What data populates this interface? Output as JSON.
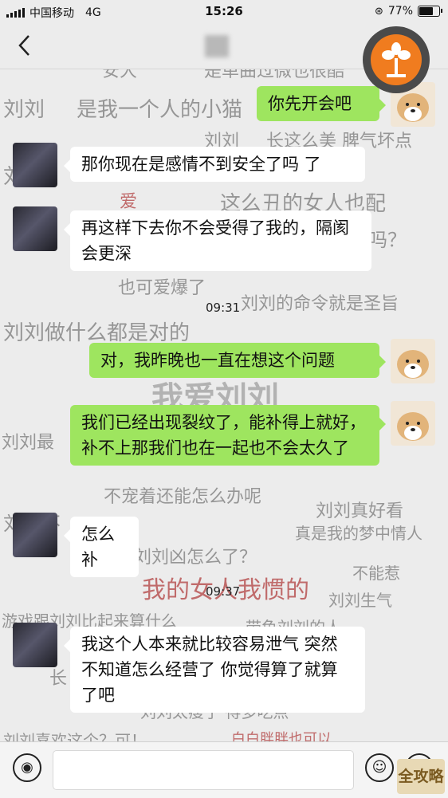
{
  "status_bar": {
    "carrier": "中国移动",
    "network": "4G",
    "time": "15:26",
    "battery_percent": "77%",
    "battery_level": 0.77
  },
  "nav": {
    "back_icon": "chevron-left-icon"
  },
  "danmaku": [
    "安大",
    "是单曲过微也很酷",
    "刘刘",
    "是我一个人的小猫",
    "刘刘",
    "长这么美 脾气坏点",
    "刘",
    "爱",
    "这么丑的女人也配",
    "吗？",
    "也可爱爆了",
    "刘刘的命令就是圣旨",
    "刘刘做什么都是对的",
    "我爱刘刘",
    "刘刘最",
    "不宠着还能怎么办呢",
    "刘刘真好看",
    "刘刘不",
    "真是我的梦中情人",
    "刘刘凶怎么了？",
    "不能惹",
    "我的女人我惯的",
    "刘刘生气",
    "游戏跟刘刘比起来算什么",
    "带鱼刘刘的人",
    "长",
    "刘刘太瘦了 得多吃点",
    "刘刘喜欢这个？可！",
    "白白胖胖也可以"
  ],
  "messages": [
    {
      "side": "out",
      "text": "你先开会吧"
    },
    {
      "side": "in",
      "text": "那你现在是感情不到安全了吗  了"
    },
    {
      "side": "in",
      "text": "再这样下去你不会受得了我的，隔阂会更深"
    },
    {
      "side": "out",
      "text": "对，我昨晚也一直在想这个问题"
    },
    {
      "side": "out",
      "text": "我们已经出现裂纹了，能补得上就好，补不上那我们也在一起也不会太久了"
    },
    {
      "side": "in",
      "text": "怎么补"
    },
    {
      "side": "in",
      "text": "我这个人本来就比较容易泄气 突然不知道怎么经营了 你觉得算了就算了吧"
    }
  ],
  "timestamps": [
    "09:31",
    "09:37"
  ],
  "input_bar": {
    "voice_icon": "voice-icon",
    "emoji_icon": "emoji-icon",
    "add_icon": "plus-icon"
  },
  "watermark_text": "全攻略"
}
